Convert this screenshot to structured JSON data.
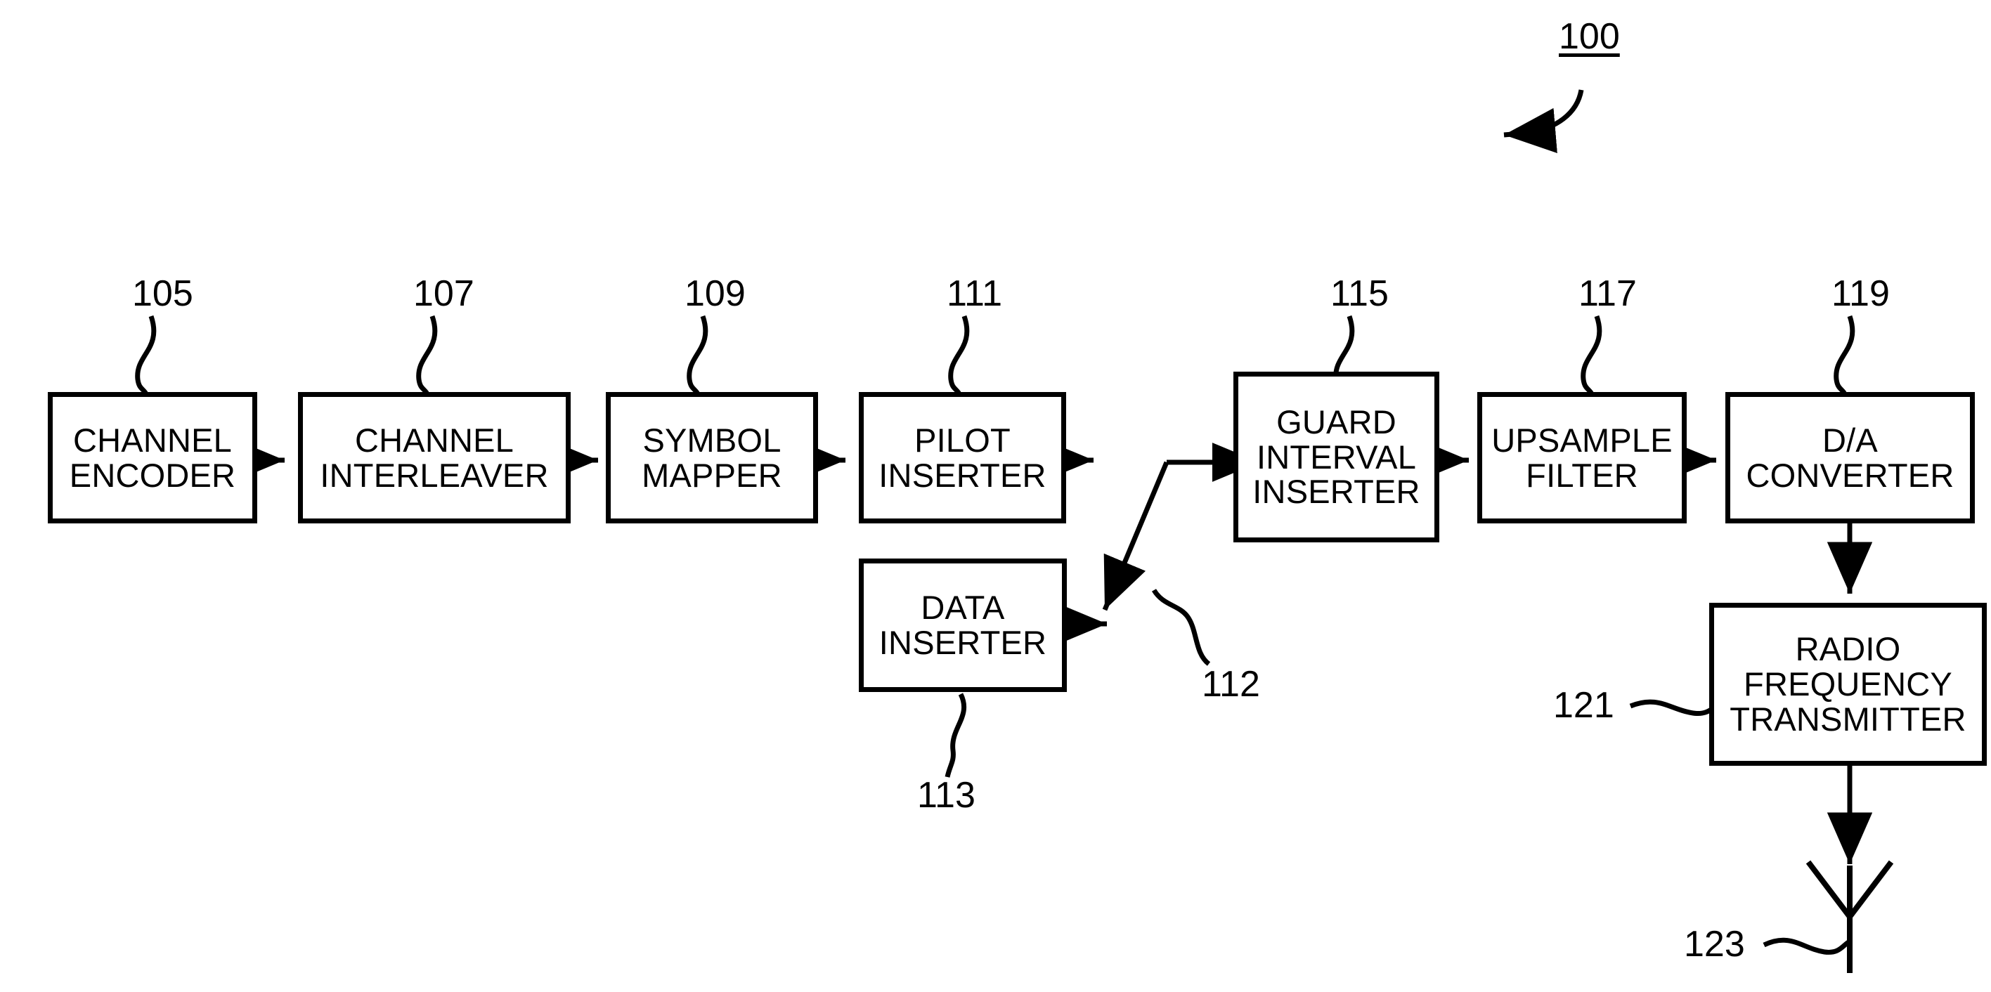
{
  "figure": {
    "kind": "patent-block-diagram",
    "stroke_color": "#000000",
    "background_color": "#ffffff",
    "figure_ref": "100"
  },
  "blocks": [
    {
      "id": "channel-encoder",
      "ref": "105",
      "label": "CHANNEL\nENCODER"
    },
    {
      "id": "channel-interleaver",
      "ref": "107",
      "label": "CHANNEL\nINTERLEAVER"
    },
    {
      "id": "symbol-mapper",
      "ref": "109",
      "label": "SYMBOL\nMAPPER"
    },
    {
      "id": "pilot-inserter",
      "ref": "111",
      "label": "PILOT\nINSERTER"
    },
    {
      "id": "data-inserter",
      "ref": "113",
      "label": "DATA\nINSERTER"
    },
    {
      "id": "guard-interval-inserter",
      "ref": "115",
      "label": "GUARD\nINTERVAL\nINSERTER"
    },
    {
      "id": "upsample-filter",
      "ref": "117",
      "label": "UPSAMPLE\nFILTER"
    },
    {
      "id": "da-converter",
      "ref": "119",
      "label": "D/A\nCONVERTER"
    },
    {
      "id": "rf-transmitter",
      "ref": "121",
      "label": "RADIO\nFREQUENCY\nTRANSMITTER"
    }
  ],
  "selector": {
    "id": "selector-switch",
    "ref": "112",
    "description": "switch-selector-arrow"
  },
  "antenna": {
    "id": "antenna",
    "ref": "123",
    "description": "antenna-symbol"
  },
  "refs": {
    "r100": "100",
    "r105": "105",
    "r107": "107",
    "r109": "109",
    "r111": "111",
    "r112": "112",
    "r113": "113",
    "r115": "115",
    "r117": "117",
    "r119": "119",
    "r121": "121",
    "r123": "123"
  },
  "labels": {
    "channel_encoder": "CHANNEL\nENCODER",
    "channel_interleaver": "CHANNEL\nINTERLEAVER",
    "symbol_mapper": "SYMBOL\nMAPPER",
    "pilot_inserter": "PILOT\nINSERTER",
    "data_inserter": "DATA\nINSERTER",
    "guard_interval_inserter": "GUARD\nINTERVAL\nINSERTER",
    "upsample_filter": "UPSAMPLE\nFILTER",
    "da_converter": "D/A\nCONVERTER",
    "rf_transmitter": "RADIO\nFREQUENCY\nTRANSMITTER"
  }
}
